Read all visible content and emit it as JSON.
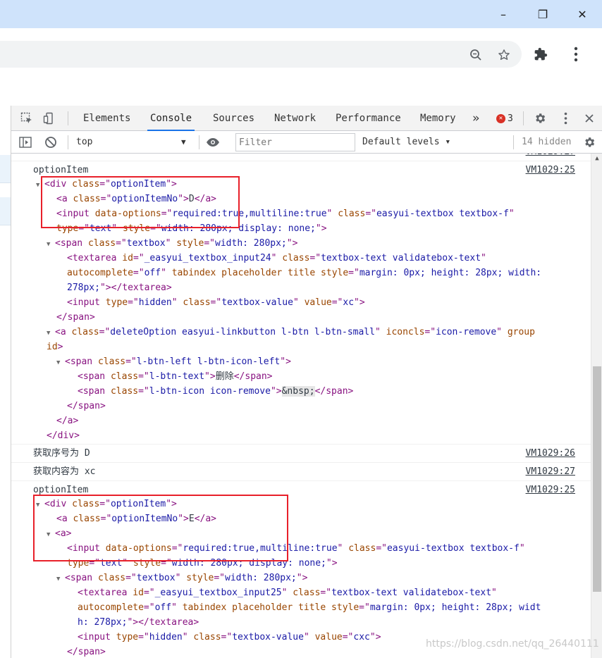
{
  "window": {
    "minimize_glyph": "–",
    "maximize_glyph": "❐",
    "close_glyph": "✕"
  },
  "toolbar_icons": {
    "zoom": "zoom-icon",
    "star": "star-icon",
    "extensions": "puzzle-icon",
    "menu": "kebab-menu-icon"
  },
  "devtools": {
    "tabs": [
      {
        "label": "Elements"
      },
      {
        "label": "Console"
      },
      {
        "label": "Sources"
      },
      {
        "label": "Network"
      },
      {
        "label": "Performance"
      },
      {
        "label": "Memory"
      }
    ],
    "more_tabs": "»",
    "error_count": "3",
    "context": "top",
    "filter_placeholder": "Filter",
    "levels_label": "Default levels ▾",
    "hidden_count": "14 hidden"
  },
  "console": {
    "entries": {
      "first_label": "optionItem",
      "first_src": "VM1029:25",
      "seq_label": "获取序号为 D",
      "seq_src": "VM1029:26",
      "content_label": "获取内容为 xc",
      "content_src": "VM1029:27",
      "second_label": "optionItem",
      "second_src": "VM1029:25",
      "partial_src": "VM1029:27"
    }
  },
  "watermark": "https://blog.csdn.net/qq_26440111"
}
